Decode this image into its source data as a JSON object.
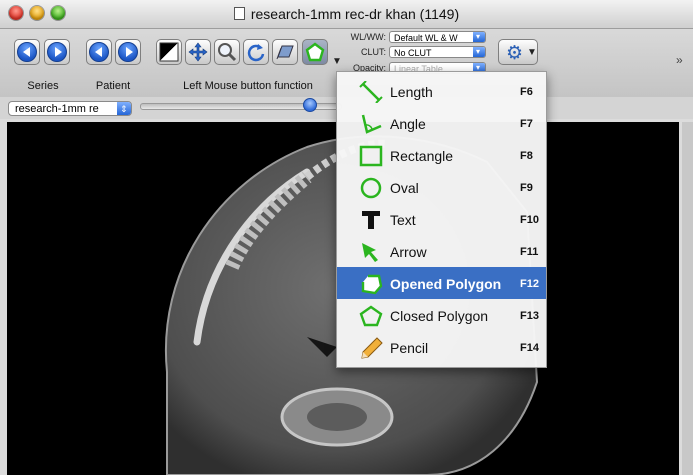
{
  "window": {
    "title": "research-1mm rec-dr khan (1149)"
  },
  "toolbar": {
    "groups": {
      "series": "Series",
      "patient": "Patient",
      "mouse_function": "Left Mouse button function"
    },
    "wlww_label": "WL/WW:",
    "wlww_value": "Default WL & W",
    "clut_label": "CLUT:",
    "clut_value": "No CLUT",
    "opacity_label": "Opacity:",
    "opacity_value": "Linear Table"
  },
  "series_popup": {
    "value": "research-1mm re"
  },
  "slider": {
    "position_fraction": 0.84
  },
  "tool_menu": {
    "items": [
      {
        "label": "Length",
        "shortcut": "F6",
        "icon": "length-icon"
      },
      {
        "label": "Angle",
        "shortcut": "F7",
        "icon": "angle-icon"
      },
      {
        "label": "Rectangle",
        "shortcut": "F8",
        "icon": "rectangle-icon"
      },
      {
        "label": "Oval",
        "shortcut": "F9",
        "icon": "oval-icon"
      },
      {
        "label": "Text",
        "shortcut": "F10",
        "icon": "text-icon"
      },
      {
        "label": "Arrow",
        "shortcut": "F11",
        "icon": "arrow-icon"
      },
      {
        "label": "Opened Polygon",
        "shortcut": "F12",
        "icon": "opened-polygon-icon",
        "highlighted": true
      },
      {
        "label": "Closed Polygon",
        "shortcut": "F13",
        "icon": "closed-polygon-icon"
      },
      {
        "label": "Pencil",
        "shortcut": "F14",
        "icon": "pencil-icon"
      }
    ]
  },
  "colors": {
    "highlight": "#3a6fc4",
    "tool_green": "#2bb51f",
    "accent_blue": "#2466d6"
  }
}
